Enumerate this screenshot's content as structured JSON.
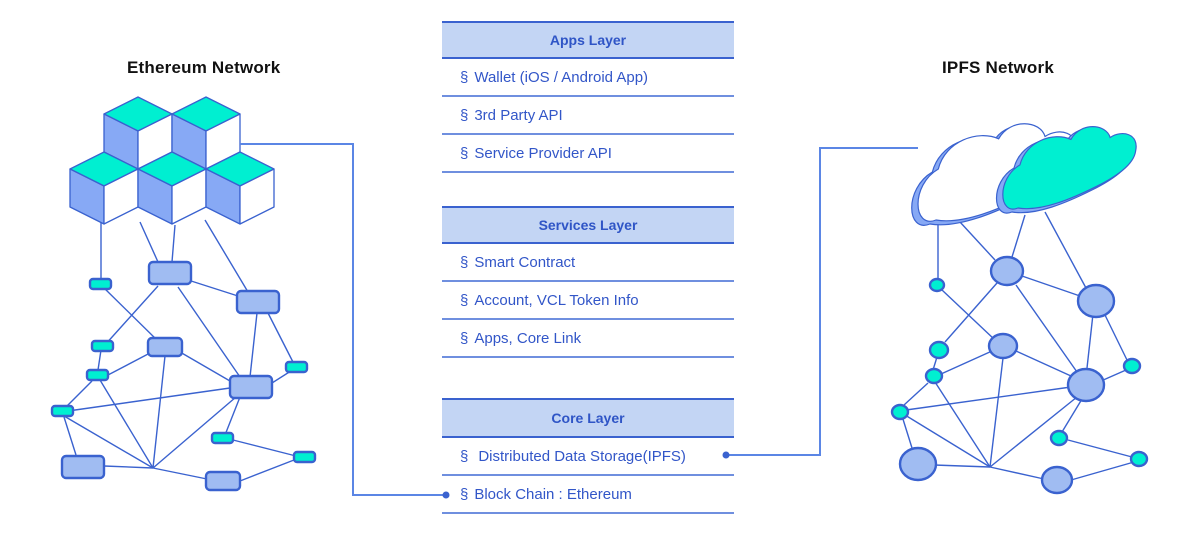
{
  "titles": {
    "ethereum": "Ethereum Network",
    "ipfs": "IPFS Network"
  },
  "layers": {
    "apps": {
      "header": "Apps Layer",
      "items": [
        "Wallet (iOS / Android App)",
        "3rd Party API",
        "Service Provider API"
      ]
    },
    "services": {
      "header": "Services Layer",
      "items": [
        "Smart Contract",
        "Account, VCL Token Info",
        "Apps, Core Link"
      ]
    },
    "core": {
      "header": "Core Layer",
      "items": [
        "Distributed Data Storage(IPFS)",
        "Block Chain : Ethereum"
      ]
    }
  },
  "bullet": "§",
  "colors": {
    "line": "#3a62cf",
    "connector": "#5b86e5",
    "teal": "#00efd1",
    "node_fill": "#a0bcf2",
    "cube_side": "#87a9f5",
    "header_fill": "#c3d5f4",
    "text_blue": "#3256c8"
  },
  "icons": {
    "ethereum": "blockchain-cubes-icon",
    "ipfs": "cloud-icon"
  }
}
